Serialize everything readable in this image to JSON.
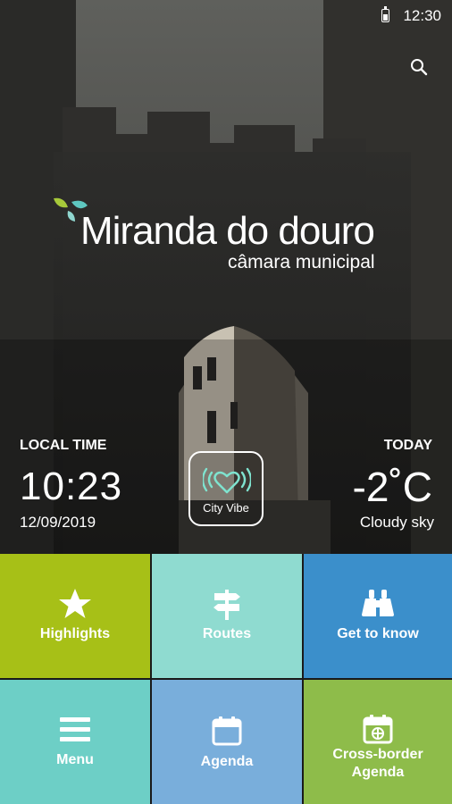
{
  "status_bar": {
    "time": "12:30"
  },
  "header": {
    "search_icon": "search-icon"
  },
  "logo": {
    "title": "Miranda do douro",
    "subtitle": "câmara municipal"
  },
  "info": {
    "local_time_label": "LOCAL TIME",
    "local_time": "10:23",
    "date": "12/09/2019",
    "today_label": "TODAY",
    "temperature": "-2˚C",
    "weather": "Cloudy sky"
  },
  "city_vibe": {
    "label": "City Vibe",
    "icon": "heart-signal-icon"
  },
  "tiles": [
    {
      "label": "Highlights",
      "icon": "star-icon",
      "color": "#a7c017"
    },
    {
      "label": "Routes",
      "icon": "signpost-icon",
      "color": "#8fdbd0"
    },
    {
      "label": "Get to know",
      "icon": "binoculars-icon",
      "color": "#3b8fcb"
    },
    {
      "label": "Menu",
      "icon": "menu-icon",
      "color": "#6dcfc6"
    },
    {
      "label": "Agenda",
      "icon": "calendar-icon",
      "color": "#79aedb"
    },
    {
      "label": "Cross-border Agenda",
      "icon": "calendar-cross-icon",
      "color": "#8ebc4a"
    }
  ]
}
